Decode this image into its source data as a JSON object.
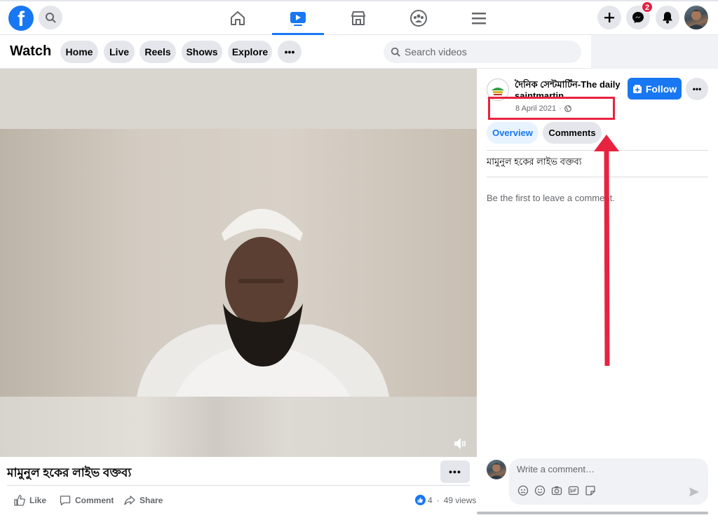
{
  "app": {
    "logo_letter": "f",
    "messenger_badge": "2"
  },
  "watch": {
    "title": "Watch",
    "tabs": [
      "Home",
      "Live",
      "Reels",
      "Shows",
      "Explore"
    ],
    "more_label": "•••",
    "search_placeholder": "Search videos"
  },
  "video": {
    "title": "মামুনুল হকের লাইভ বক্তব্য",
    "more_label": "•••",
    "actions": {
      "like": "Like",
      "comment": "Comment",
      "share": "Share"
    },
    "reactions_count": "4",
    "views": "49 views"
  },
  "side": {
    "page_name": "দৈনিক সেন্টমার্টিন-The daily saintmartin",
    "follow_label": "Follow",
    "more_label": "•••",
    "date": "8 April 2021",
    "tabs": {
      "overview": "Overview",
      "comments": "Comments"
    },
    "description": "মামুনুল হকের লাইভ বক্তব্য",
    "empty_comments": "Be the first to leave a comment.",
    "comment_placeholder": "Write a comment…"
  },
  "colors": {
    "brand": "#1877f2",
    "annotation": "#e8233f",
    "badge": "#e41e3f"
  }
}
